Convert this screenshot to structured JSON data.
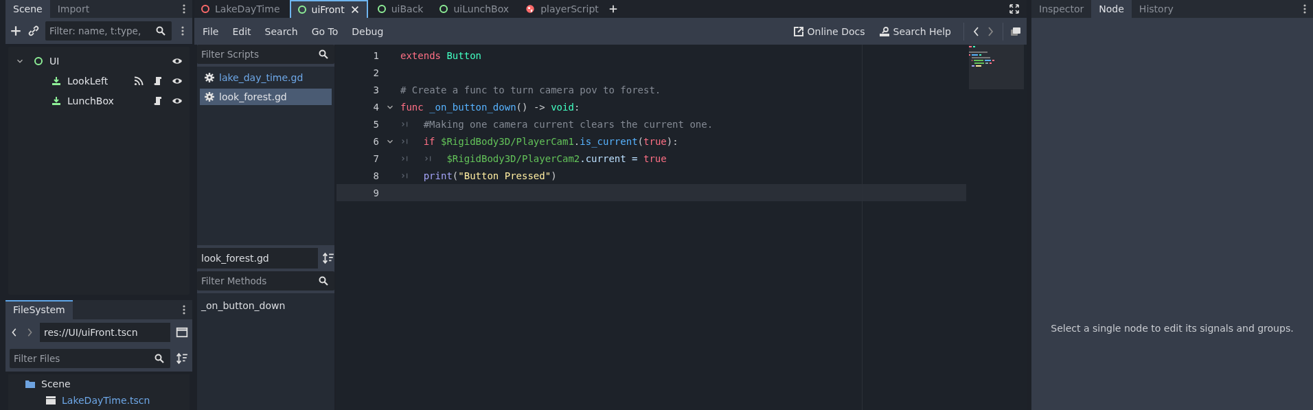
{
  "scene_dock": {
    "tabs": [
      {
        "label": "Scene",
        "selected": true
      },
      {
        "label": "Import",
        "selected": false
      }
    ],
    "filter": {
      "placeholder": "Filter: name, t:type,"
    },
    "tree": [
      {
        "name": "UI",
        "kind": "control",
        "expanded": true,
        "signals": false,
        "script": false,
        "visible": true,
        "children": [
          {
            "name": "LookLeft",
            "kind": "button",
            "signals": true,
            "script": true,
            "visible": true
          },
          {
            "name": "LunchBox",
            "kind": "button",
            "signals": false,
            "script": true,
            "visible": true
          }
        ]
      }
    ]
  },
  "filesystem_dock": {
    "tabs": [
      {
        "label": "FileSystem",
        "selected": true
      }
    ],
    "path": "res://UI/uiFront.tscn",
    "filter": {
      "placeholder": "Filter Files"
    },
    "tree": [
      {
        "name": "Scene",
        "kind": "folder",
        "children": [
          {
            "name": "LakeDayTime.tscn",
            "kind": "scene"
          }
        ]
      }
    ]
  },
  "editor_tabs": [
    {
      "label": "LakeDayTime",
      "kind": "scene",
      "color": "#ff6b6b",
      "selected": false
    },
    {
      "label": "uiFront",
      "kind": "scene",
      "color": "#8eef97",
      "selected": true
    },
    {
      "label": "uiBack",
      "kind": "scene",
      "color": "#8eef97",
      "selected": false
    },
    {
      "label": "uiLunchBox",
      "kind": "scene",
      "color": "#8eef97",
      "selected": false
    },
    {
      "label": "playerScript",
      "kind": "globe",
      "color": "#ff6b6b",
      "selected": false
    }
  ],
  "menu": [
    "File",
    "Edit",
    "Search",
    "Go To",
    "Debug"
  ],
  "help_buttons": [
    {
      "label": "Online Docs",
      "kind": "external"
    },
    {
      "label": "Search Help",
      "kind": "doc"
    }
  ],
  "scripts": {
    "filter": {
      "placeholder": "Filter Scripts"
    },
    "items": [
      {
        "name": "lake_day_time.gd",
        "highlighted": true,
        "selected": false
      },
      {
        "name": "look_forest.gd",
        "highlighted": false,
        "selected": true
      }
    ],
    "current": "look_forest.gd",
    "methods_filter": {
      "placeholder": "Filter Methods"
    },
    "methods": [
      "_on_button_down"
    ]
  },
  "code": [
    {
      "number": "1",
      "fold": false,
      "current": false,
      "tokens": [
        {
          "kind": "keyword",
          "text": "extends "
        },
        {
          "kind": "type",
          "text": "Button"
        }
      ]
    },
    {
      "number": "2",
      "fold": false,
      "current": false
    },
    {
      "number": "3",
      "fold": false,
      "current": false,
      "tokens": [
        {
          "kind": "comment",
          "text": "# Create a func to turn camera pov to forest."
        }
      ]
    },
    {
      "number": "4",
      "fold": true,
      "current": false,
      "tokens": [
        {
          "kind": "keyword",
          "text": "func "
        },
        {
          "kind": "function",
          "text": "_on_button_down"
        },
        {
          "kind": "plain",
          "text": "() -> "
        },
        {
          "kind": "type",
          "text": "void"
        },
        {
          "kind": "plain",
          "text": ":"
        }
      ]
    },
    {
      "number": "5",
      "fold": false,
      "current": false,
      "tokens": [
        {
          "kind": "tab"
        },
        {
          "kind": "comment",
          "text": "#Making one camera current clears the current one."
        }
      ]
    },
    {
      "number": "6",
      "fold": true,
      "current": false,
      "tokens": [
        {
          "kind": "tab"
        },
        {
          "kind": "keyword",
          "text": "if "
        },
        {
          "kind": "nodepath",
          "text": "$RigidBody3D/PlayerCam1"
        },
        {
          "kind": "plain",
          "text": "."
        },
        {
          "kind": "function",
          "text": "is_current"
        },
        {
          "kind": "plain",
          "text": "("
        },
        {
          "kind": "keyword",
          "text": "true"
        },
        {
          "kind": "plain",
          "text": "):"
        }
      ]
    },
    {
      "number": "7",
      "fold": false,
      "current": false,
      "tokens": [
        {
          "kind": "tab"
        },
        {
          "kind": "tab"
        },
        {
          "kind": "nodepath",
          "text": "$RigidBody3D/PlayerCam2"
        },
        {
          "kind": "member",
          "text": ".current = "
        },
        {
          "kind": "keyword",
          "text": "true"
        }
      ]
    },
    {
      "number": "8",
      "fold": false,
      "current": false,
      "tokens": [
        {
          "kind": "tab"
        },
        {
          "kind": "builtin",
          "text": "print"
        },
        {
          "kind": "plain",
          "text": "("
        },
        {
          "kind": "string",
          "text": "\"Button Pressed\""
        },
        {
          "kind": "plain",
          "text": ")"
        }
      ]
    },
    {
      "number": "9",
      "fold": false,
      "current": true
    }
  ],
  "right_dock": {
    "tabs": [
      {
        "label": "Inspector",
        "selected": false
      },
      {
        "label": "Node",
        "selected": true
      },
      {
        "label": "History",
        "selected": false
      }
    ],
    "message": "Select a single node to edit its signals and groups."
  }
}
